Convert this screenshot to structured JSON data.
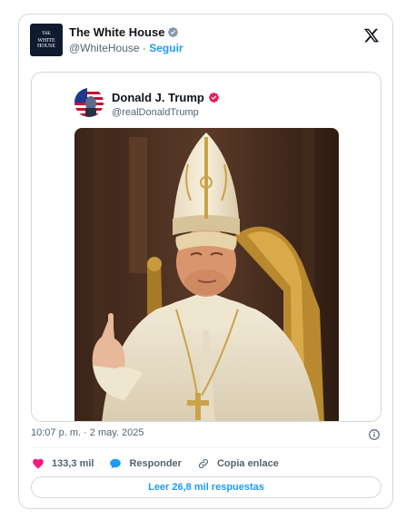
{
  "author": {
    "name": "The White House",
    "handle": "@WhiteHouse",
    "separator": "·",
    "follow_label": "Seguir",
    "avatar_text": [
      "THE",
      "WHITE",
      "HOUSE"
    ]
  },
  "quoted": {
    "name": "Donald J. Trump",
    "handle": "@realDonaldTrump"
  },
  "timestamp": "10:07 p. m. · 2 may. 2025",
  "actions": {
    "likes": "133,3 mil",
    "reply": "Responder",
    "copy_link": "Copia enlace"
  },
  "read_replies": "Leer 26,8 mil respuestas",
  "colors": {
    "accent": "#1d9bf0",
    "like": "#f91880",
    "verified_gov": "#829aab",
    "verified_pink": "#e0245e",
    "border": "#cfd9de"
  },
  "icons": [
    "verified-gray-icon",
    "x-logo-icon",
    "verified-pink-icon",
    "info-icon",
    "heart-icon",
    "reply-bubble-icon",
    "link-icon"
  ]
}
